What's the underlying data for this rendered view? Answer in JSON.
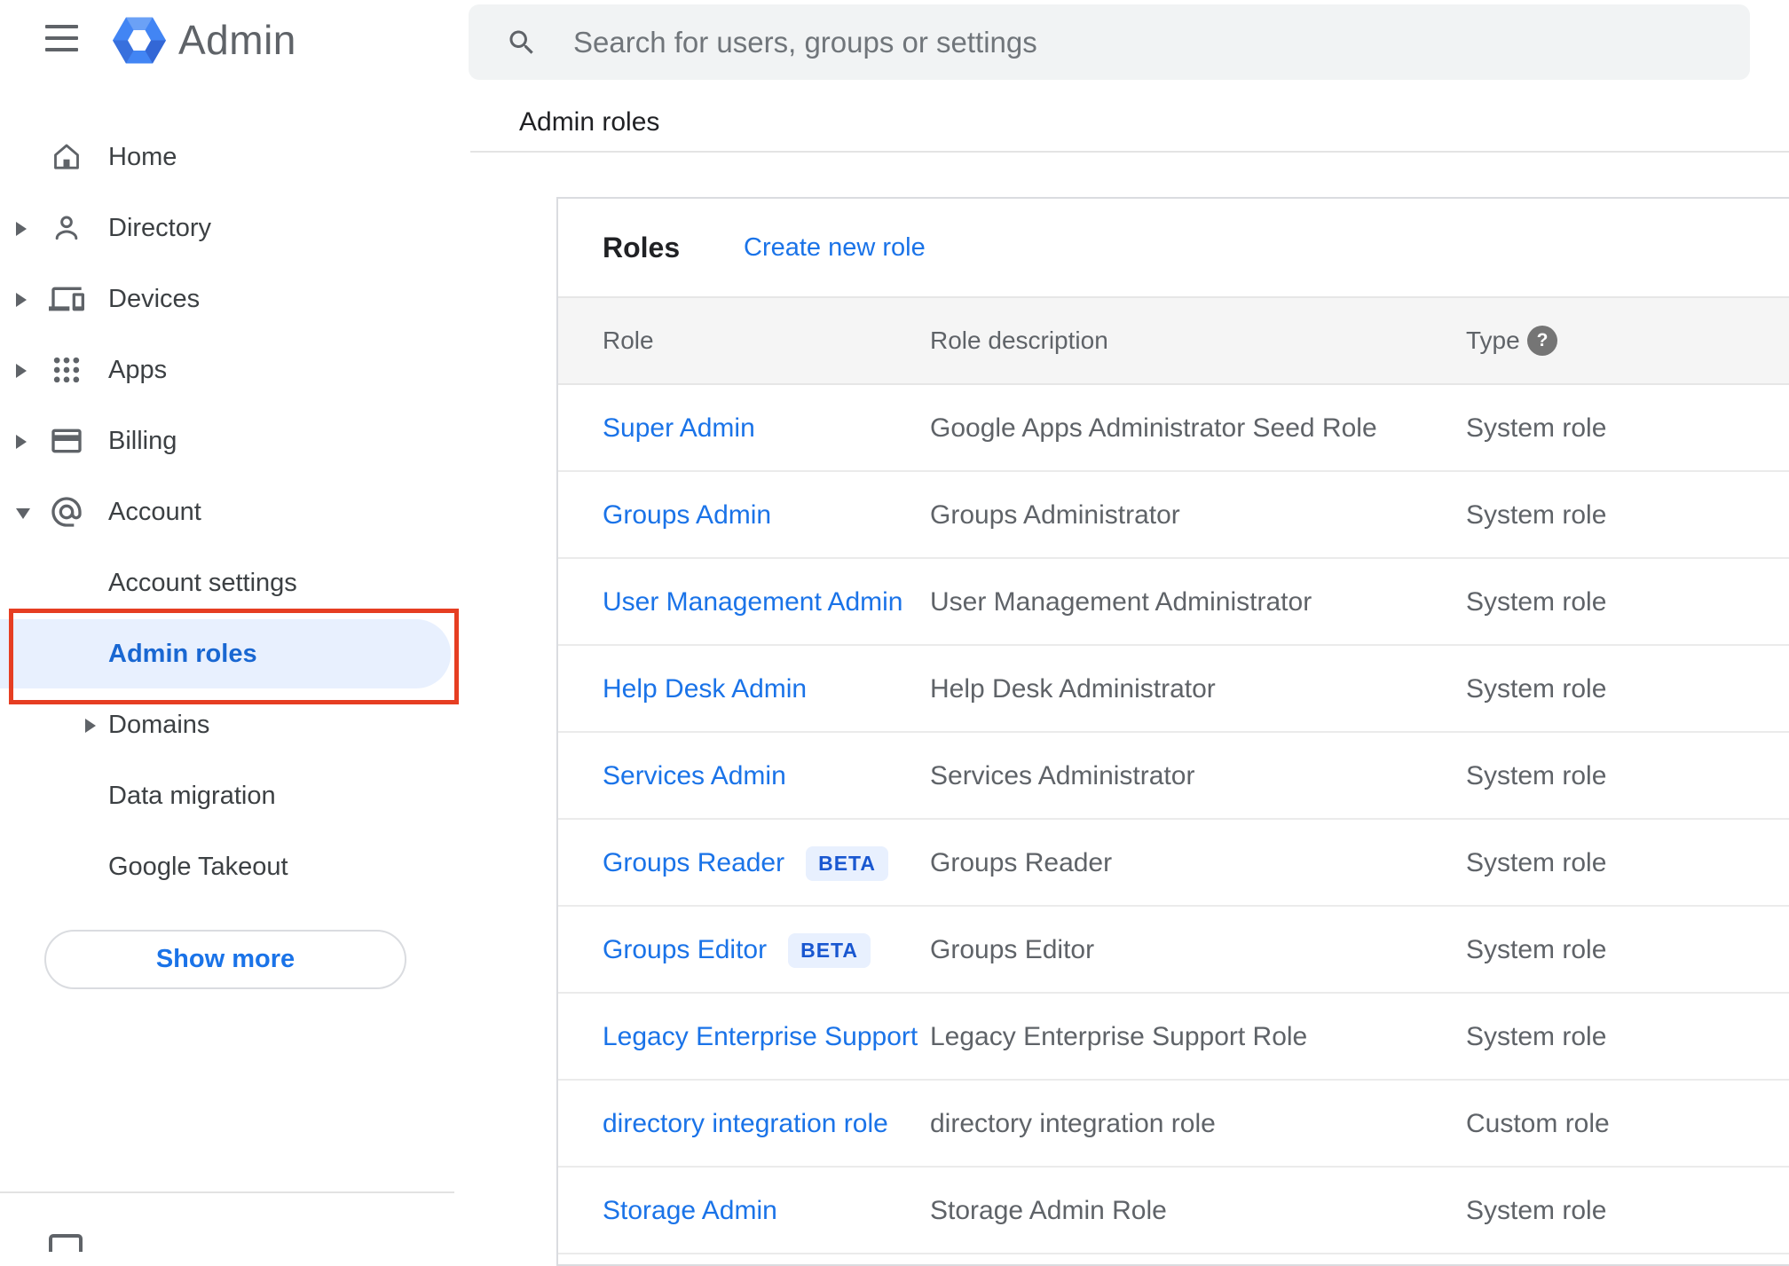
{
  "app": {
    "title": "Admin"
  },
  "topbar": {
    "search_placeholder": "Search for users, groups or settings",
    "breadcrumb": "Admin roles"
  },
  "sidebar": {
    "items": [
      {
        "label": "Home",
        "icon": "home"
      },
      {
        "label": "Directory",
        "icon": "person",
        "arrow": "right"
      },
      {
        "label": "Devices",
        "icon": "devices",
        "arrow": "right"
      },
      {
        "label": "Apps",
        "icon": "apps",
        "arrow": "right"
      },
      {
        "label": "Billing",
        "icon": "credit-card",
        "arrow": "right"
      },
      {
        "label": "Account",
        "icon": "at-sign",
        "arrow": "down"
      },
      {
        "label": "Account settings",
        "sub": true
      },
      {
        "label": "Admin roles",
        "sub": true,
        "selected": true,
        "annotated": true
      },
      {
        "label": "Domains",
        "sub": true,
        "arrow": "right"
      },
      {
        "label": "Data migration",
        "sub": true
      },
      {
        "label": "Google Takeout",
        "sub": true
      }
    ],
    "show_more_label": "Show more"
  },
  "roles_panel": {
    "title": "Roles",
    "create_link": "Create new role",
    "columns": [
      "Role",
      "Role description",
      "Type"
    ],
    "type_help_glyph": "?",
    "beta_label": "BETA",
    "rows": [
      {
        "role": "Super Admin",
        "beta": false,
        "description": "Google Apps Administrator Seed Role",
        "type": "System role"
      },
      {
        "role": "Groups Admin",
        "beta": false,
        "description": "Groups Administrator",
        "type": "System role"
      },
      {
        "role": "User Management Admin",
        "beta": false,
        "description": "User Management Administrator",
        "type": "System role"
      },
      {
        "role": "Help Desk Admin",
        "beta": false,
        "description": "Help Desk Administrator",
        "type": "System role"
      },
      {
        "role": "Services Admin",
        "beta": false,
        "description": "Services Administrator",
        "type": "System role"
      },
      {
        "role": "Groups Reader",
        "beta": true,
        "description": "Groups Reader",
        "type": "System role"
      },
      {
        "role": "Groups Editor",
        "beta": true,
        "description": "Groups Editor",
        "type": "System role"
      },
      {
        "role": "Legacy Enterprise Support",
        "beta": false,
        "description": "Legacy Enterprise Support Role",
        "type": "System role"
      },
      {
        "role": "directory integration role",
        "beta": false,
        "description": "directory integration role",
        "type": "Custom role"
      },
      {
        "role": "Storage Admin",
        "beta": false,
        "description": "Storage Admin Role",
        "type": "System role"
      }
    ]
  },
  "colors": {
    "link_blue": "#1a73e8",
    "selected_blue": "#1967d2",
    "selected_bg": "#e8f0fe",
    "annotation_red": "#e63e22",
    "header_band": "#f5f5f5",
    "search_bg": "#f1f3f4",
    "icon_gray": "#5f6368"
  }
}
